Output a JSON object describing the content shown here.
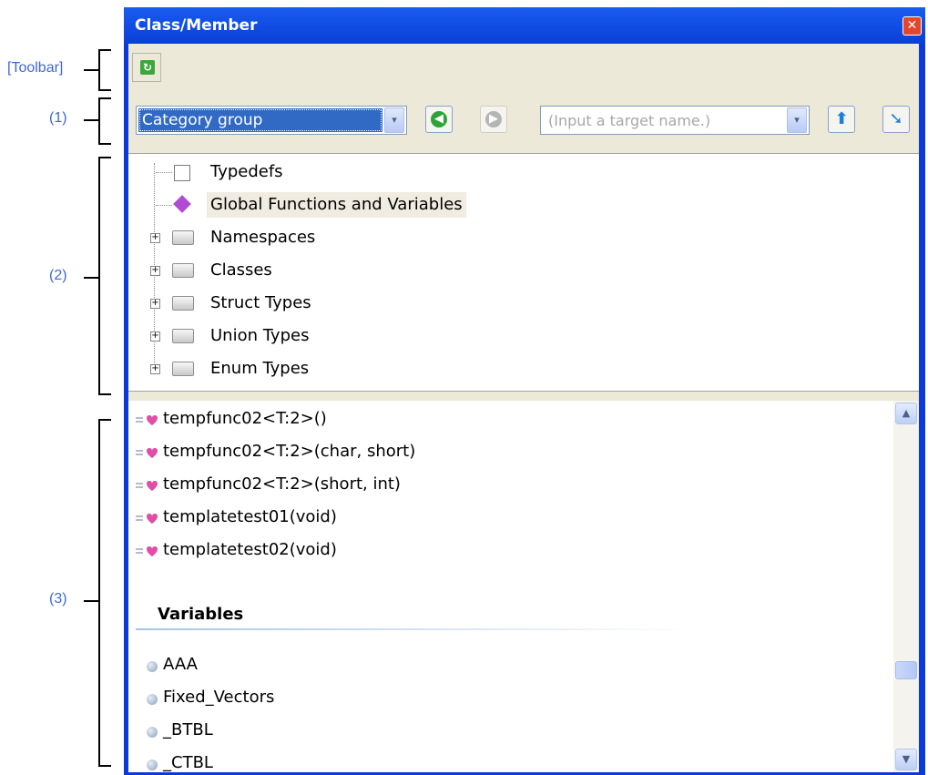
{
  "annotations": {
    "toolbar": "[Toolbar]",
    "area1": "(1)",
    "area2": "(2)",
    "area3": "(3)"
  },
  "window": {
    "title": "Class/Member",
    "close_glyph": "✕"
  },
  "toolbar": {
    "refresh_icon": "refresh-icon",
    "refresh_glyph": "↻"
  },
  "navbar": {
    "category_select": "Category group",
    "target_placeholder": "(Input a target name.)",
    "dropdown_glyph": "▾",
    "back_glyph": "◀",
    "forward_glyph": "▶",
    "up_glyph": "⬆",
    "down_glyph": "➘"
  },
  "tree": {
    "items": [
      {
        "label": "Typedefs",
        "expandable": false,
        "icon": "typedef-icon"
      },
      {
        "label": "Global Functions and Variables",
        "expandable": false,
        "icon": "global-icon",
        "selected": true
      },
      {
        "label": "Namespaces",
        "expandable": true,
        "icon": "folder-icon"
      },
      {
        "label": "Classes",
        "expandable": true,
        "icon": "folder-icon"
      },
      {
        "label": "Struct Types",
        "expandable": true,
        "icon": "folder-icon"
      },
      {
        "label": "Union Types",
        "expandable": true,
        "icon": "folder-icon"
      },
      {
        "label": "Enum Types",
        "expandable": true,
        "icon": "folder-icon"
      }
    ],
    "expander_glyph": "+"
  },
  "list": {
    "functions": [
      "tempfunc02<T:2>()",
      "tempfunc02<T:2>(char, short)",
      "tempfunc02<T:2>(short, int)",
      "templatetest01(void)",
      "templatetest02(void)"
    ],
    "variables_header": "Variables",
    "variables": [
      "AAA",
      "Fixed_Vectors",
      "_BTBL",
      "_CTBL"
    ],
    "scroll_up_glyph": "▲",
    "scroll_down_glyph": "▼"
  }
}
